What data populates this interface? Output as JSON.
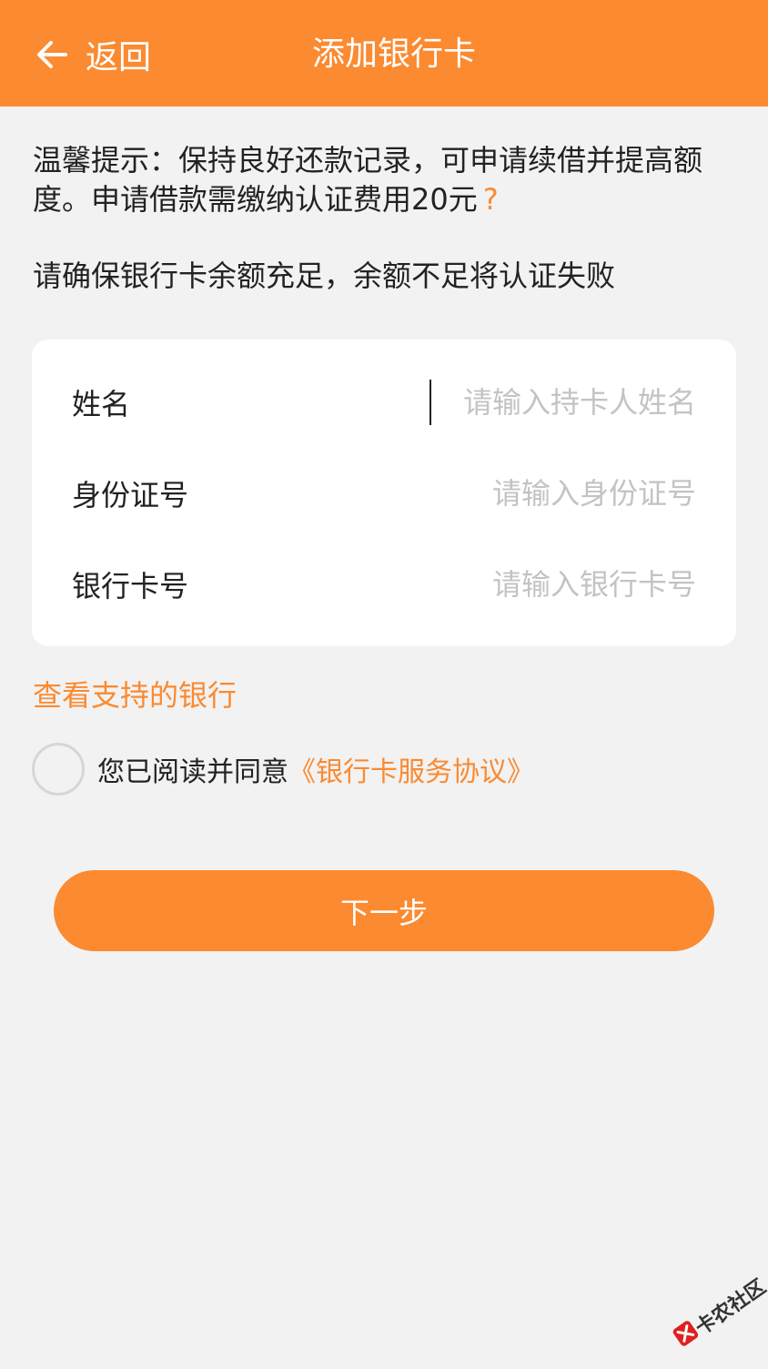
{
  "header": {
    "back_label": "返回",
    "title": "添加银行卡"
  },
  "tip": {
    "text": "温馨提示：保持良好还款记录，可申请续借并提高额度。申请借款需缴纳认证费用20元",
    "help_mark": "?"
  },
  "notice": "请确保银行卡余额充足，余额不足将认证失败",
  "form": {
    "rows": [
      {
        "label": "姓名",
        "placeholder": "请输入持卡人姓名",
        "value": ""
      },
      {
        "label": "身份证号",
        "placeholder": "请输入身份证号",
        "value": ""
      },
      {
        "label": "银行卡号",
        "placeholder": "请输入银行卡号",
        "value": ""
      }
    ]
  },
  "support_link": "查看支持的银行",
  "agreement": {
    "text": "您已阅读并同意",
    "link": "《银行卡服务协议》",
    "checked": false
  },
  "next_button": "下一步",
  "watermark": "卡农社区",
  "colors": {
    "brand": "#fb8a30",
    "background": "#f2f2f2",
    "placeholder": "#c3c3c3"
  }
}
